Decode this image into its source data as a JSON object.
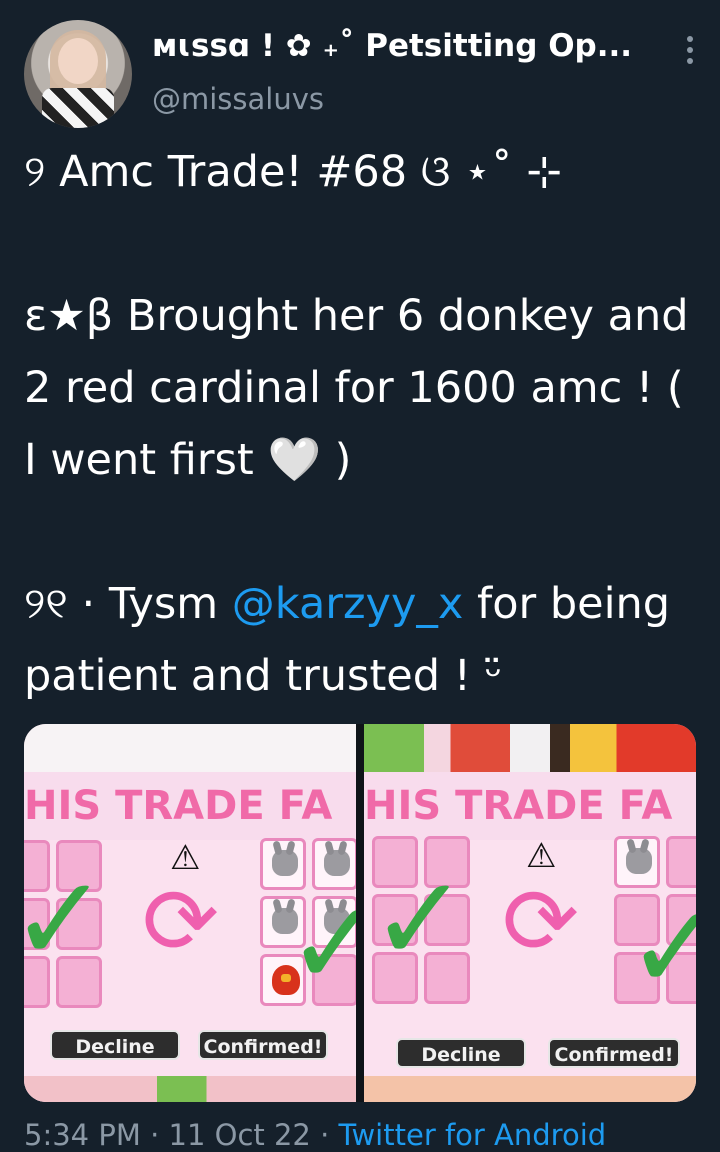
{
  "user": {
    "display_name": "ᴍɩꜱꜱɑ ! ✿ ₊˚ Petsitting Op...",
    "handle": "@missaluvs"
  },
  "tweet": {
    "line1": "୨ Amc Trade! #68 ଓ ⋆˚ ⊹",
    "line2": "ε★β Brought her 6 donkey and 2 red cardinal for 1600 amc ! ( I went first 🤍 )",
    "line3_prefix": "୨୧ · Tysm ",
    "mention": "@karzyy_x",
    "line3_suffix": " for being patient and trusted ! ᵕ̈"
  },
  "media": {
    "left": {
      "banner": "HIS TRADE FA",
      "decline": "Decline",
      "confirm": "Confirmed!"
    },
    "right": {
      "banner": "HIS TRADE FA",
      "decline": "Decline",
      "confirm": "Confirmed!"
    }
  },
  "footer": {
    "meta": "5:34 PM · 11 Oct 22 · ",
    "source": "Twitter for Android"
  },
  "colors": {
    "background": "#15202b",
    "link": "#1d9bf0",
    "secondary_text": "#8b98a5"
  }
}
